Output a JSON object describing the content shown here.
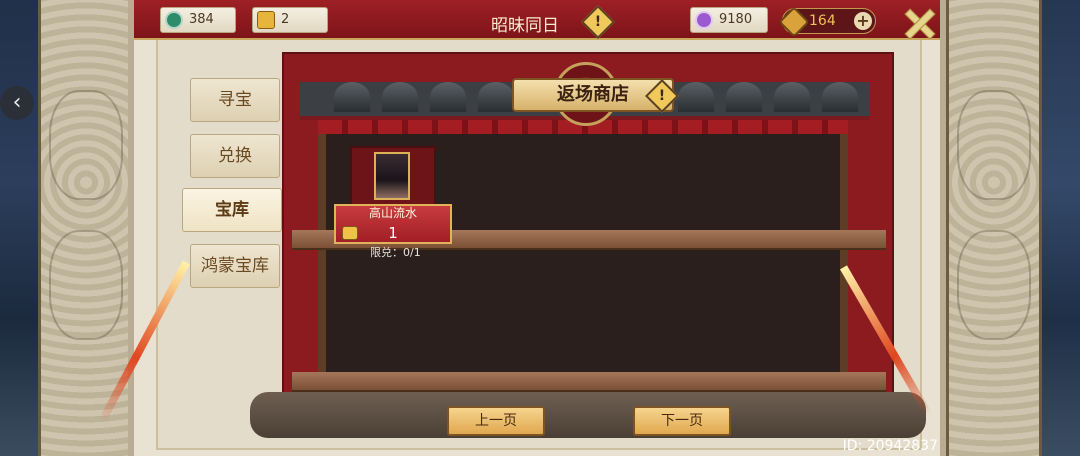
{
  "resources": {
    "silver": {
      "value": "384",
      "icon": "jade-coin-icon"
    },
    "gold_ingot": {
      "value": "2",
      "icon": "ingot-icon"
    },
    "crystal": {
      "value": "9180",
      "icon": "purple-gem-icon"
    },
    "gold": {
      "value": "164",
      "icon": "gold-token-icon"
    }
  },
  "header": {
    "title": "昭昧同日",
    "info_icon": "!"
  },
  "tabs": [
    {
      "label": "寻宝",
      "active": false
    },
    {
      "label": "兑换",
      "active": false
    },
    {
      "label": "宝库",
      "active": true
    },
    {
      "label": "鸿蒙宝库",
      "active": false
    }
  ],
  "shop": {
    "title": "返场商店",
    "info_icon": "!"
  },
  "items": [
    {
      "name": "高山流水",
      "price": "1",
      "limit": "限兑：0/1"
    }
  ],
  "pagination": {
    "prev": "上一页",
    "next": "下一页"
  },
  "footer": {
    "id_text": "ID: 20942837"
  },
  "colors": {
    "accent_red": "#8c1b20",
    "gold": "#f0c25a",
    "panel_beige": "#e4dccb"
  }
}
